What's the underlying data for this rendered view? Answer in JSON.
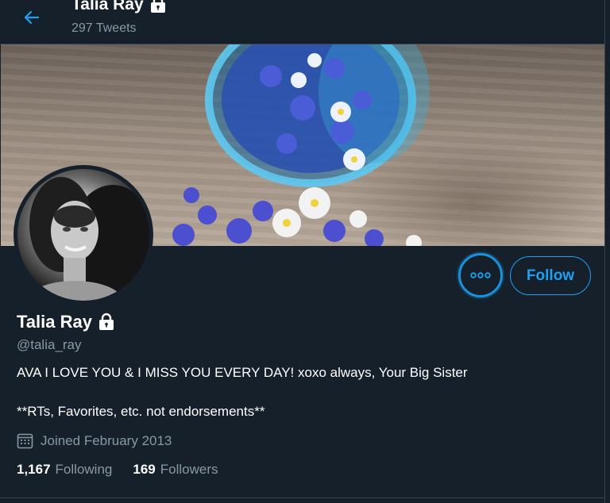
{
  "header": {
    "name": "Talia Ray",
    "tweet_count": "297 Tweets"
  },
  "profile": {
    "name": "Talia Ray",
    "handle": "@talia_ray",
    "bio_line1": "AVA I LOVE YOU & I MISS YOU EVERY DAY! xoxo always, Your Big Sister",
    "bio_line2": "**RTs, Favorites, etc. not endorsements**",
    "joined": "Joined February 2013",
    "following_count": "1,167",
    "following_label": "Following",
    "followers_count": "169",
    "followers_label": "Followers"
  },
  "buttons": {
    "follow_label": "Follow"
  },
  "icons": {
    "back": "arrow-left-icon",
    "lock": "lock-icon",
    "more": "more-horizontal-icon",
    "calendar": "calendar-icon"
  },
  "colors": {
    "background": "#15202b",
    "accent": "#1da1f2",
    "secondary_text": "#8899a6",
    "border": "#38444d"
  }
}
